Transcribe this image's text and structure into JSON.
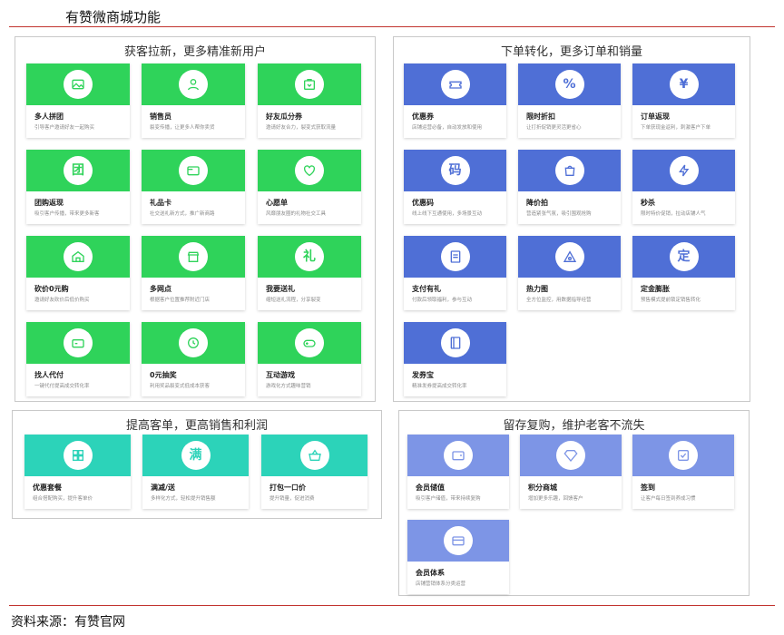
{
  "header": {
    "title": "有赞微商城功能"
  },
  "footer": {
    "source": "资料来源：有赞官网"
  },
  "sections": [
    {
      "title": "获客拉新，更多精准新用户",
      "cards": [
        {
          "title": "多人拼团",
          "desc": "引导客户邀请好友一起购买",
          "icon": "image-icon"
        },
        {
          "title": "销售员",
          "desc": "裂变传播，让更多人帮你卖货",
          "icon": "person-icon"
        },
        {
          "title": "好友瓜分券",
          "desc": "邀请好友合力，裂变式获取流量",
          "icon": "coupon-bag-icon"
        },
        {
          "title": "团购返现",
          "desc": "吸引客户传播，带来更多新客",
          "icon": "group-icon"
        },
        {
          "title": "礼品卡",
          "desc": "社交送礼新方式，推广新商路",
          "icon": "card-icon"
        },
        {
          "title": "心愿单",
          "desc": "风靡朋友圈的礼物社交工具",
          "icon": "heart-icon"
        },
        {
          "title": "砍价0元购",
          "desc": "邀请好友砍价后低价购买",
          "icon": "house-icon"
        },
        {
          "title": "多网点",
          "desc": "根据客户位置推荐附近门店",
          "icon": "store-icon"
        },
        {
          "title": "我要送礼",
          "desc": "缩短送礼流程，分享裂变",
          "icon": "gift-icon"
        },
        {
          "title": "找人代付",
          "desc": "一键代付提高成交转化率",
          "icon": "pay-icon"
        },
        {
          "title": "0元抽奖",
          "desc": "利用奖品裂变式低成本获客",
          "icon": "lottery-icon"
        },
        {
          "title": "互动游戏",
          "desc": "游戏化方式趣味营销",
          "icon": "gamepad-icon"
        }
      ]
    },
    {
      "title": "下单转化，更多订单和销量",
      "cards": [
        {
          "title": "优惠券",
          "desc": "店铺运营必备，自动发放和使用",
          "icon": "ticket-icon"
        },
        {
          "title": "限时折扣",
          "desc": "让打折促销更灵活更省心",
          "icon": "percent-icon"
        },
        {
          "title": "订单返现",
          "desc": "下单获现金返利，刺激客户下单",
          "icon": "yen-icon"
        },
        {
          "title": "优惠码",
          "desc": "线上线下互通使用，多场景互动",
          "icon": "code-icon"
        },
        {
          "title": "降价拍",
          "desc": "营造紧张气氛，吸引围观抢购",
          "icon": "price-bag-icon"
        },
        {
          "title": "秒杀",
          "desc": "限时特价促销，拉动店铺人气",
          "icon": "lightning-icon"
        },
        {
          "title": "支付有礼",
          "desc": "付款后领取福利，参与互动",
          "icon": "receipt-icon"
        },
        {
          "title": "热力图",
          "desc": "全方位监控，用数据指导经营",
          "icon": "heatmap-icon"
        },
        {
          "title": "定金膨胀",
          "desc": "预售模式提前锁定销售转化",
          "icon": "deposit-icon"
        },
        {
          "title": "发券宝",
          "desc": "精准发券提高成交转化率",
          "icon": "book-icon"
        }
      ]
    },
    {
      "title": "提高客单，更高销售和利润",
      "cards": [
        {
          "title": "优惠套餐",
          "desc": "组合搭配购买，提升客单价",
          "icon": "grid-icon"
        },
        {
          "title": "满减/送",
          "desc": "多样化方式，轻松提升销售额",
          "icon": "full-icon",
          "glyph": "满"
        },
        {
          "title": "打包一口价",
          "desc": "提升销量，促进消费",
          "icon": "basket-icon"
        }
      ]
    },
    {
      "title": "留存复购，维护老客不流失",
      "cards": [
        {
          "title": "会员储值",
          "desc": "吸引客户储值，带来持续复购",
          "icon": "wallet-icon"
        },
        {
          "title": "积分商城",
          "desc": "增加更多乐趣，回馈客户",
          "icon": "diamond-icon"
        },
        {
          "title": "签到",
          "desc": "让客户每日签到养成习惯",
          "icon": "checkbox-icon"
        },
        {
          "title": "会员体系",
          "desc": "店铺营销体系分类运营",
          "icon": "member-card-icon"
        }
      ]
    }
  ],
  "glyphs": {
    "group-icon": "团",
    "code-icon": "码",
    "gift-icon": "礼",
    "full-icon": "满",
    "yen-icon": "¥",
    "percent-icon": "%",
    "deposit-icon": "定"
  }
}
